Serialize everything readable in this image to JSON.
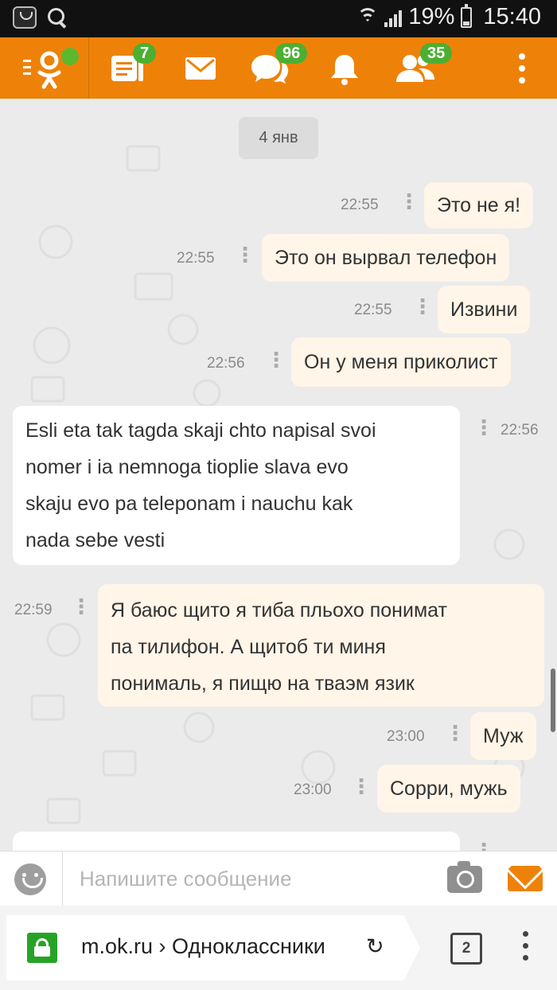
{
  "status_bar": {
    "battery": "19%",
    "time": "15:40"
  },
  "nav": {
    "feed_badge": "7",
    "discussions_badge": "96",
    "friends_badge": "35"
  },
  "chat": {
    "date": "4 янв",
    "messages": [
      {
        "dir": "out",
        "time": "22:55",
        "text": "Это не я!"
      },
      {
        "dir": "out",
        "time": "22:55",
        "text": "Это он вырвал телефон"
      },
      {
        "dir": "out",
        "time": "22:55",
        "text": "Извини"
      },
      {
        "dir": "out",
        "time": "22:56",
        "text": "Он у меня приколист"
      },
      {
        "dir": "in",
        "time": "22:56",
        "lines": [
          "Esli eta tak tagda skaji chto napisal svoi",
          "nomer i ia nemnoga tioplie slava evo",
          "skaju evo pa teleponam i nauchu kak",
          "nada sebe vesti"
        ]
      },
      {
        "dir": "out",
        "time": "22:59",
        "lines": [
          "Я баюс щито я тиба пльохо понимат",
          "па тилифон. А щитоб ти миня",
          "понималь, я пищю на тваэм язик"
        ]
      },
      {
        "dir": "out",
        "time": "23:00",
        "text": "Муж"
      },
      {
        "dir": "out",
        "time": "23:00",
        "text": "Сорри,  мужь"
      }
    ]
  },
  "composer": {
    "placeholder": "Напишите сообщение"
  },
  "browser": {
    "url": "m.ok.ru › Одноклассники",
    "tab_count": "2"
  },
  "colors": {
    "brand": "#ee8208",
    "badge": "#4caf32",
    "outgoing_bubble": "#fff5e8"
  }
}
